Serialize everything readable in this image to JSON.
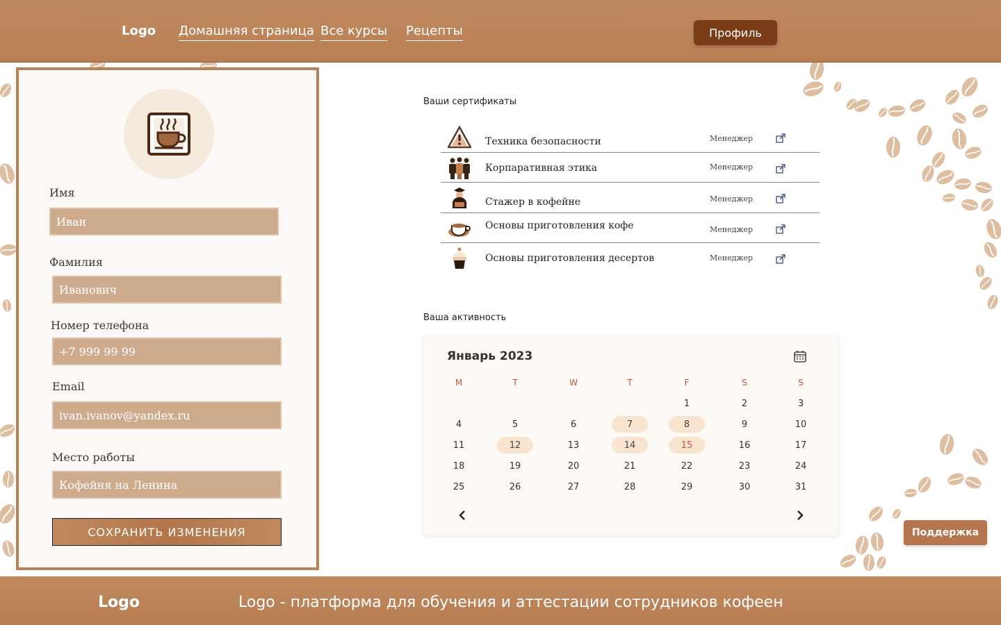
{
  "header": {
    "logo": "Logo",
    "nav": [
      "Домашняя страница",
      "Все курсы",
      "Рецепты"
    ],
    "profile_button": "Профиль"
  },
  "profile": {
    "avatar_icon": "coffee-cup-icon",
    "fields": [
      {
        "label": "Имя",
        "value": "Иван"
      },
      {
        "label": "Фамилия",
        "value": "Иванович"
      },
      {
        "label": "Номер телефона",
        "value": "+7 999 99 99"
      },
      {
        "label": "Email",
        "value": "ivan.ivanov@yandex.ru"
      },
      {
        "label": "Место работы",
        "value": "Кофейня на Ленина"
      }
    ],
    "save_button": "СОХРАНИТЬ ИЗМЕНЕНИЯ"
  },
  "certificates": {
    "title": "Ваши сертификаты",
    "items": [
      {
        "icon": "warning-icon",
        "name": "Техника безопасности",
        "role": "Менеджер"
      },
      {
        "icon": "team-icon",
        "name": "Корпаративная этика",
        "role": "Менеджер"
      },
      {
        "icon": "graduate-icon",
        "name": "Стажер в кофейне",
        "role": "Менеджер"
      },
      {
        "icon": "coffee-cup-icon",
        "name": "Основы приготовления кофе",
        "role": "Менеджер"
      },
      {
        "icon": "cupcake-icon",
        "name": "Основы приготовления десертов",
        "role": "Менеджер"
      }
    ]
  },
  "activity": {
    "title": "Ваша активность",
    "calendar": {
      "month": "Январь 2023",
      "weekdays": [
        "M",
        "T",
        "W",
        "T",
        "F",
        "S",
        "S"
      ],
      "weeks": [
        [
          "",
          "",
          "",
          "",
          "1",
          "2",
          "3"
        ],
        [
          "4",
          "5",
          "6",
          "7",
          "8",
          "9",
          "10"
        ],
        [
          "11",
          "12",
          "13",
          "14",
          "15",
          "16",
          "17"
        ],
        [
          "18",
          "19",
          "20",
          "21",
          "22",
          "23",
          "24"
        ],
        [
          "25",
          "26",
          "27",
          "28",
          "29",
          "30",
          "31"
        ]
      ],
      "highlighted_days": [
        "7",
        "8",
        "12",
        "14",
        "15"
      ],
      "accent_days": [
        "15"
      ]
    }
  },
  "support_button": "Поддержка",
  "footer": {
    "logo": "Logo",
    "tagline": "Logo - платформа для обучения и аттестации сотрудников кофеен"
  },
  "colors": {
    "brand": "#b97f55",
    "dark_accent": "#7a3c18",
    "highlight": "#f9e4cf",
    "weekday": "#c0553a"
  }
}
